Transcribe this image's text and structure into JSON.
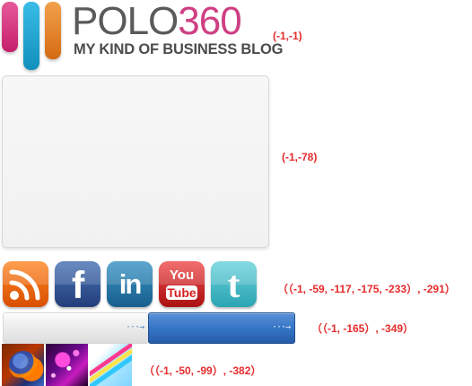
{
  "logo": {
    "title_main": "POLO",
    "title_accent": "360",
    "tagline": "MY KIND OF BUSINESS BLOG",
    "coordinate_label": "(-1,-1)"
  },
  "panel": {
    "coordinate_label": "(-1,-78)"
  },
  "social_icons": {
    "facebook_glyph": "f",
    "linkedin_glyph": "in",
    "youtube_glyph_top": "You",
    "youtube_glyph_bottom": "Tube",
    "twitter_glyph": "t",
    "coordinate_label": "（（-1, -59, -117, -175, -233）, -291）"
  },
  "buttons": {
    "light_arrow": "···→",
    "dark_arrow": "···→",
    "coordinate_label": "（（-1, -165）, -349）"
  },
  "thumbnails": {
    "coordinate_label": "（（-1, -50, -99）, -382）"
  },
  "colors": {
    "accent_label": "#e52b2b",
    "logo_pink": "#cf3f83",
    "logo_blue": "#25a9d8",
    "logo_orange": "#e7892c"
  },
  "icons": [
    "rss-icon",
    "facebook-icon",
    "linkedin-icon",
    "youtube-icon",
    "twitter-icon",
    "arrow-right-icon"
  ]
}
